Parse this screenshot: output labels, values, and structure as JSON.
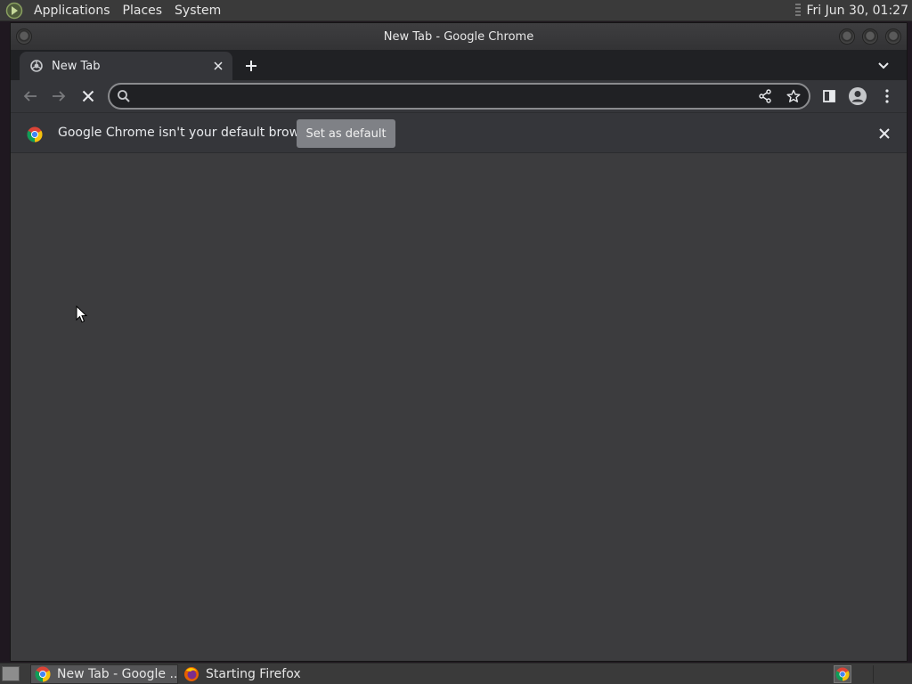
{
  "top_panel": {
    "menus": [
      "Applications",
      "Places",
      "System"
    ],
    "clock": "Fri Jun 30, 01:27"
  },
  "window": {
    "title": "New Tab - Google Chrome"
  },
  "tabs": [
    {
      "title": "New Tab",
      "active": true
    }
  ],
  "toolbar": {
    "omnibox_value": ""
  },
  "infobar": {
    "message": "Google Chrome isn't your default browser",
    "button_label": "Set as default"
  },
  "taskbar": {
    "tasks": [
      {
        "label": "New Tab - Google ...",
        "active": true,
        "icon": "chrome-icon"
      },
      {
        "label": "Starting Firefox",
        "active": false,
        "icon": "firefox-icon"
      }
    ]
  },
  "colors": {
    "chrome_frame": "#202124",
    "toolbar": "#35363a",
    "content": "#3c3c3e",
    "set_default_button": "#7f8186"
  }
}
